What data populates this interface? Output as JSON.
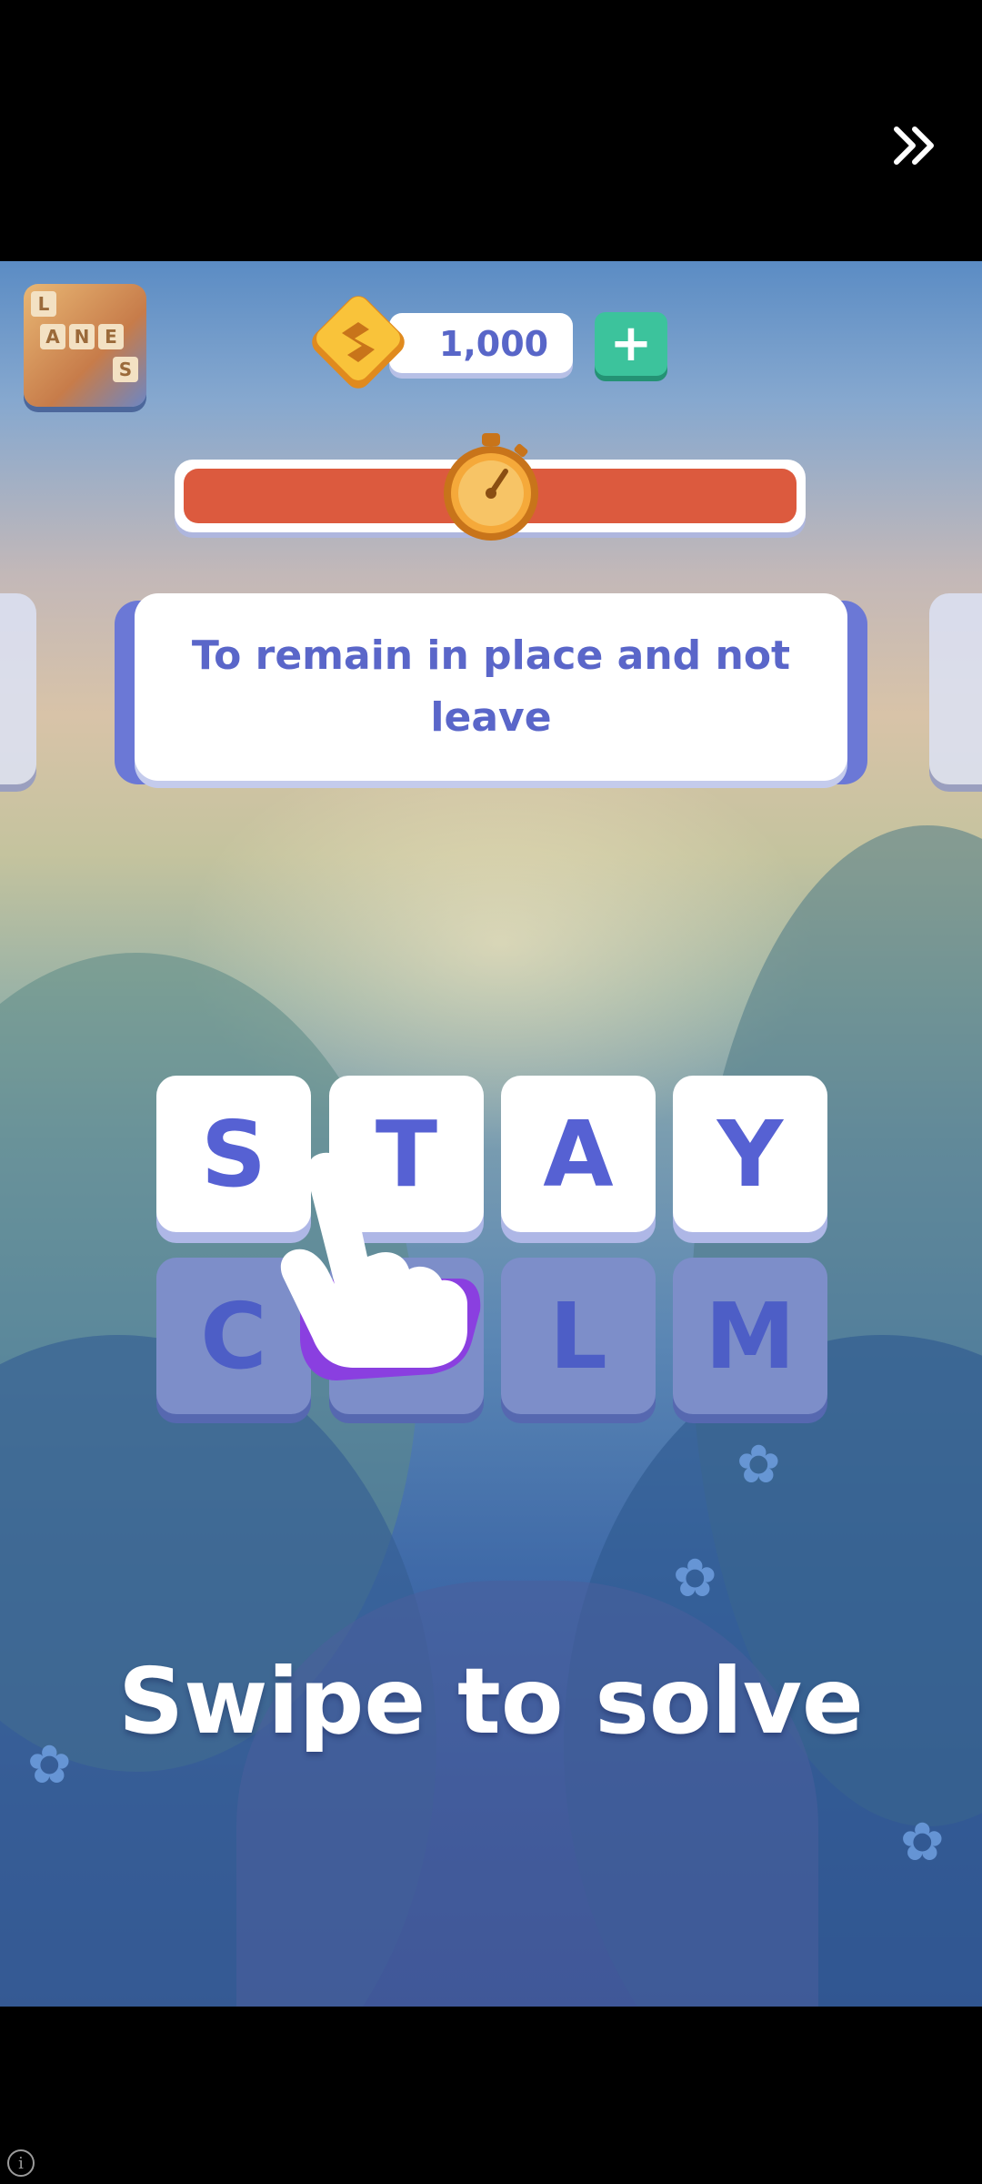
{
  "header": {
    "skip_icon": "double-chevron-right-icon"
  },
  "game": {
    "logo": {
      "icon": "lanes-logo-icon",
      "letters": [
        "L",
        "A",
        "N",
        "E",
        "S"
      ]
    },
    "coins": {
      "amount": "1,000",
      "icon": "coin-icon",
      "add_label": "+"
    },
    "timer": {
      "icon": "stopwatch-icon",
      "remaining": 1.0,
      "fill_color": "#dc5a3e"
    },
    "clue": {
      "text": "To remain in place and not leave"
    },
    "board": {
      "rows": [
        {
          "state": "solved",
          "letters": [
            "S",
            "T",
            "A",
            "Y"
          ]
        },
        {
          "state": "unsolved",
          "letters": [
            "C",
            "",
            "L",
            "M"
          ]
        }
      ]
    },
    "hint_hand_icon": "pointing-hand-icon",
    "instruction": "Swipe to solve"
  },
  "footer": {
    "info_icon": "info-icon",
    "info_label": "i"
  },
  "colors": {
    "accent": "#5661d3",
    "add_button": "#3cc39c",
    "timer": "#dc5a3e"
  }
}
